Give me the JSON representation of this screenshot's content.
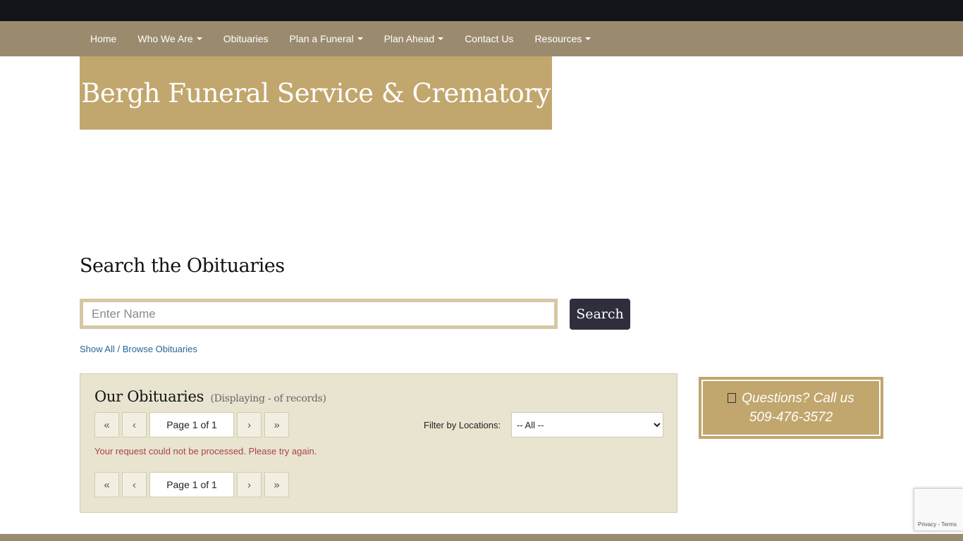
{
  "nav": {
    "items": [
      {
        "label": "Home",
        "dropdown": false
      },
      {
        "label": "Who We Are",
        "dropdown": true
      },
      {
        "label": "Obituaries",
        "dropdown": false
      },
      {
        "label": "Plan a Funeral",
        "dropdown": true
      },
      {
        "label": "Plan Ahead",
        "dropdown": true
      },
      {
        "label": "Contact Us",
        "dropdown": false
      },
      {
        "label": "Resources",
        "dropdown": true
      }
    ]
  },
  "brand": {
    "title": "Bergh Funeral Service & Crematory"
  },
  "search": {
    "heading": "Search the Obituaries",
    "placeholder": "Enter Name",
    "value": "",
    "button_label": "Search",
    "show_all_link": "Show All / Browse Obituaries"
  },
  "obituaries": {
    "title": "Our Obituaries",
    "subtitle": "(Displaying - of records)",
    "pager": {
      "first": "«",
      "prev": "‹",
      "page_info": "Page 1 of 1",
      "next": "›",
      "last": "»"
    },
    "filter_label": "Filter by Locations:",
    "filter_selected": "-- All --",
    "error": "Your request could not be processed. Please try again."
  },
  "callbox": {
    "icon": "phone-icon",
    "line1": "Questions? Call us",
    "phone": "509-476-3572"
  },
  "recaptcha": {
    "links": "Privacy - Terms"
  },
  "colors": {
    "topbar": "#111418",
    "navbar": "#9b8b6e",
    "gold": "#c1a66d",
    "panel": "#e8e4d0",
    "search_button": "#2f2e3b",
    "link": "#2a6496",
    "error": "#a94442"
  }
}
